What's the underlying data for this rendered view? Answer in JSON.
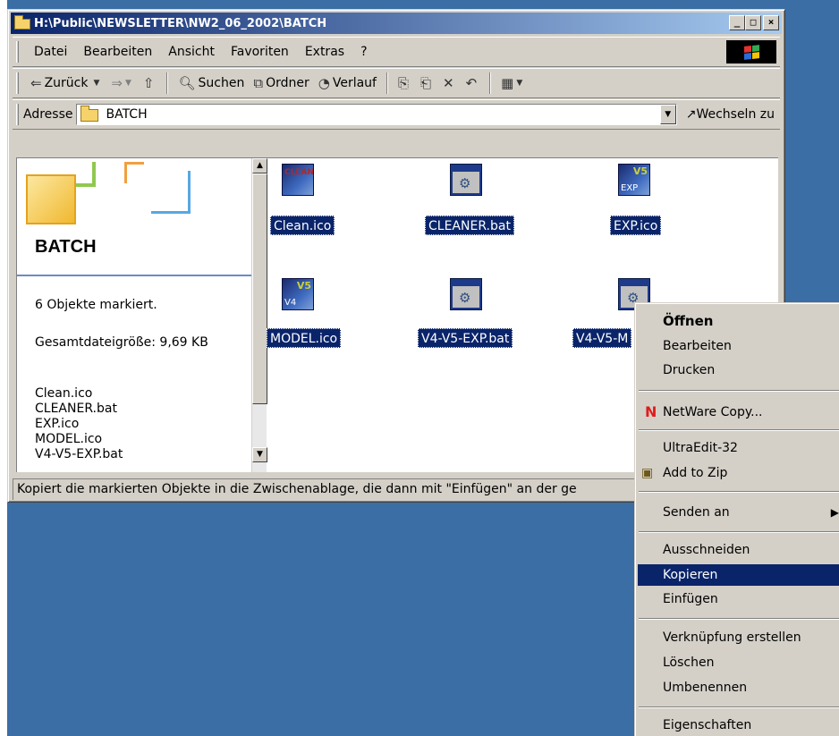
{
  "window": {
    "title": "H:\\Public\\NEWSLETTER\\NW2_06_2002\\BATCH",
    "buttons": {
      "minimize": "_",
      "maximize": "□",
      "close": "×"
    }
  },
  "menubar": [
    "Datei",
    "Bearbeiten",
    "Ansicht",
    "Favoriten",
    "Extras",
    "?"
  ],
  "toolbar": {
    "back": "Zurück",
    "search": "Suchen",
    "folders": "Ordner",
    "history": "Verlauf"
  },
  "address": {
    "label": "Adresse",
    "value": "BATCH",
    "go": "Wechseln zu"
  },
  "info_pane": {
    "title": "BATCH",
    "selected": "6 Objekte markiert.",
    "total_size": "Gesamtdateigröße: 9,69 KB",
    "files": [
      "Clean.ico",
      "CLEANER.bat",
      "EXP.ico",
      "MODEL.ico",
      "V4-V5-EXP.bat"
    ]
  },
  "files": [
    {
      "name": "Clean.ico",
      "type": "ico",
      "icon_text": "CLEAN"
    },
    {
      "name": "CLEANER.bat",
      "type": "bat"
    },
    {
      "name": "EXP.ico",
      "type": "ico",
      "icon_text": "V5",
      "icon_text2": "EXP"
    },
    {
      "name": "MODEL.ico",
      "type": "ico",
      "icon_text": "V5",
      "icon_text2": "V4"
    },
    {
      "name": "V4-V5-EXP.bat",
      "type": "bat"
    },
    {
      "name": "V4-V5-M",
      "type": "bat"
    }
  ],
  "status_text": "Kopiert die markierten Objekte in die Zwischenablage, die dann mit \"Einfügen\" an der ge",
  "context_menu": {
    "open": "Öffnen",
    "edit": "Bearbeiten",
    "print": "Drucken",
    "netware_copy": "NetWare Copy...",
    "netware_icon": "N",
    "ultraedit": "UltraEdit-32",
    "add_to_zip": "Add to Zip",
    "send_to": "Senden an",
    "cut": "Ausschneiden",
    "copy": "Kopieren",
    "paste": "Einfügen",
    "create_shortcut": "Verknüpfung erstellen",
    "delete": "Löschen",
    "rename": "Umbenennen",
    "properties": "Eigenschaften"
  },
  "colors": {
    "desktop": "#3a6ea5",
    "window_face": "#d4d0c8",
    "titlebar_start": "#0a246a",
    "titlebar_end": "#a6caf0",
    "selection": "#0a246a"
  }
}
